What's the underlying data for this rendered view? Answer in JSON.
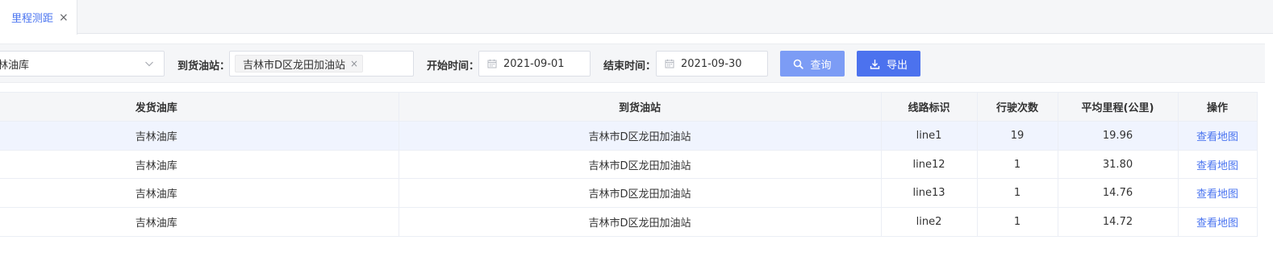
{
  "tabs": [
    {
      "label": "里程测距",
      "close": "×"
    }
  ],
  "filter": {
    "depot_value": "林油库",
    "station_label": "到货油站：",
    "station_tag": "吉林市D区龙田加油站",
    "station_tag_close": "×",
    "start_label": "开始时间：",
    "start_value": "2021-09-01",
    "end_label": "结束时间：",
    "end_value": "2021-09-30",
    "query_label": "查询",
    "export_label": "导出"
  },
  "table": {
    "columns": [
      "发货油库",
      "到货油站",
      "线路标识",
      "行驶次数",
      "平均里程(公里)",
      "操作"
    ],
    "rows": [
      {
        "depot": "吉林油库",
        "station": "吉林市D区龙田加油站",
        "line": "line1",
        "trips": "19",
        "avg_km": "19.96",
        "action": "查看地图"
      },
      {
        "depot": "吉林油库",
        "station": "吉林市D区龙田加油站",
        "line": "line12",
        "trips": "1",
        "avg_km": "31.80",
        "action": "查看地图"
      },
      {
        "depot": "吉林油库",
        "station": "吉林市D区龙田加油站",
        "line": "line13",
        "trips": "1",
        "avg_km": "14.76",
        "action": "查看地图"
      },
      {
        "depot": "吉林油库",
        "station": "吉林市D区龙田加油站",
        "line": "line2",
        "trips": "1",
        "avg_km": "14.72",
        "action": "查看地图"
      }
    ]
  },
  "colors": {
    "accent": "#4a74f0",
    "query_button": "#7c9cf5",
    "export_button": "#4c72ee",
    "row_highlight": "#f0f4fe"
  },
  "icons": {
    "tab_close": "close-icon",
    "select_arrow": "chevron-down-icon",
    "date": "calendar-icon",
    "query": "search-icon",
    "export": "download-icon"
  }
}
